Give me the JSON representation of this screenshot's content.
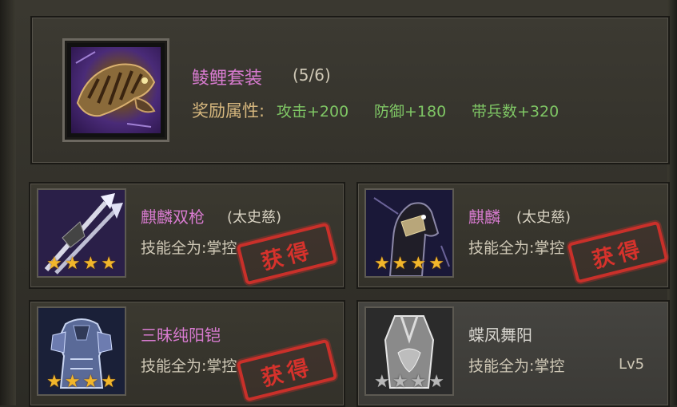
{
  "set": {
    "title": "鲮鲤套装",
    "count": "(5/6)",
    "reward_label": "奖励属性:",
    "stats": [
      "攻击+200",
      "防御+180",
      "带兵数+320"
    ],
    "icon": "armadillo-armor-set-icon"
  },
  "items": [
    {
      "name": "麒麟双枪",
      "hero": "(太史慈)",
      "skill": "技能全为:掌控",
      "stars": 4,
      "stars_color": "gold",
      "obtained": true,
      "stamp": "获得",
      "portrait": "twin-spears-icon"
    },
    {
      "name": "麒麟",
      "hero": "(太史慈)",
      "skill": "技能全为:掌控",
      "stars": 4,
      "stars_color": "gold",
      "obtained": true,
      "stamp": "获得",
      "portrait": "armored-horse-icon"
    },
    {
      "name": "三昧纯阳铠",
      "hero": "",
      "skill": "技能全为:掌控",
      "stars": 4,
      "stars_color": "gold",
      "obtained": true,
      "stamp": "获得",
      "portrait": "armor-icon"
    },
    {
      "name": "蝶凤舞阳",
      "hero": "",
      "skill": "技能全为:掌控",
      "level": "Lv5",
      "stars": 4,
      "stars_color": "gray",
      "obtained": false,
      "portrait": "robe-icon"
    }
  ],
  "colors": {
    "item_name": "#d87bd0",
    "stat_green": "#7fc765",
    "reward_gold": "#d6b77e",
    "stamp_red": "#c9302a",
    "star_gold": "#f2b62b"
  }
}
